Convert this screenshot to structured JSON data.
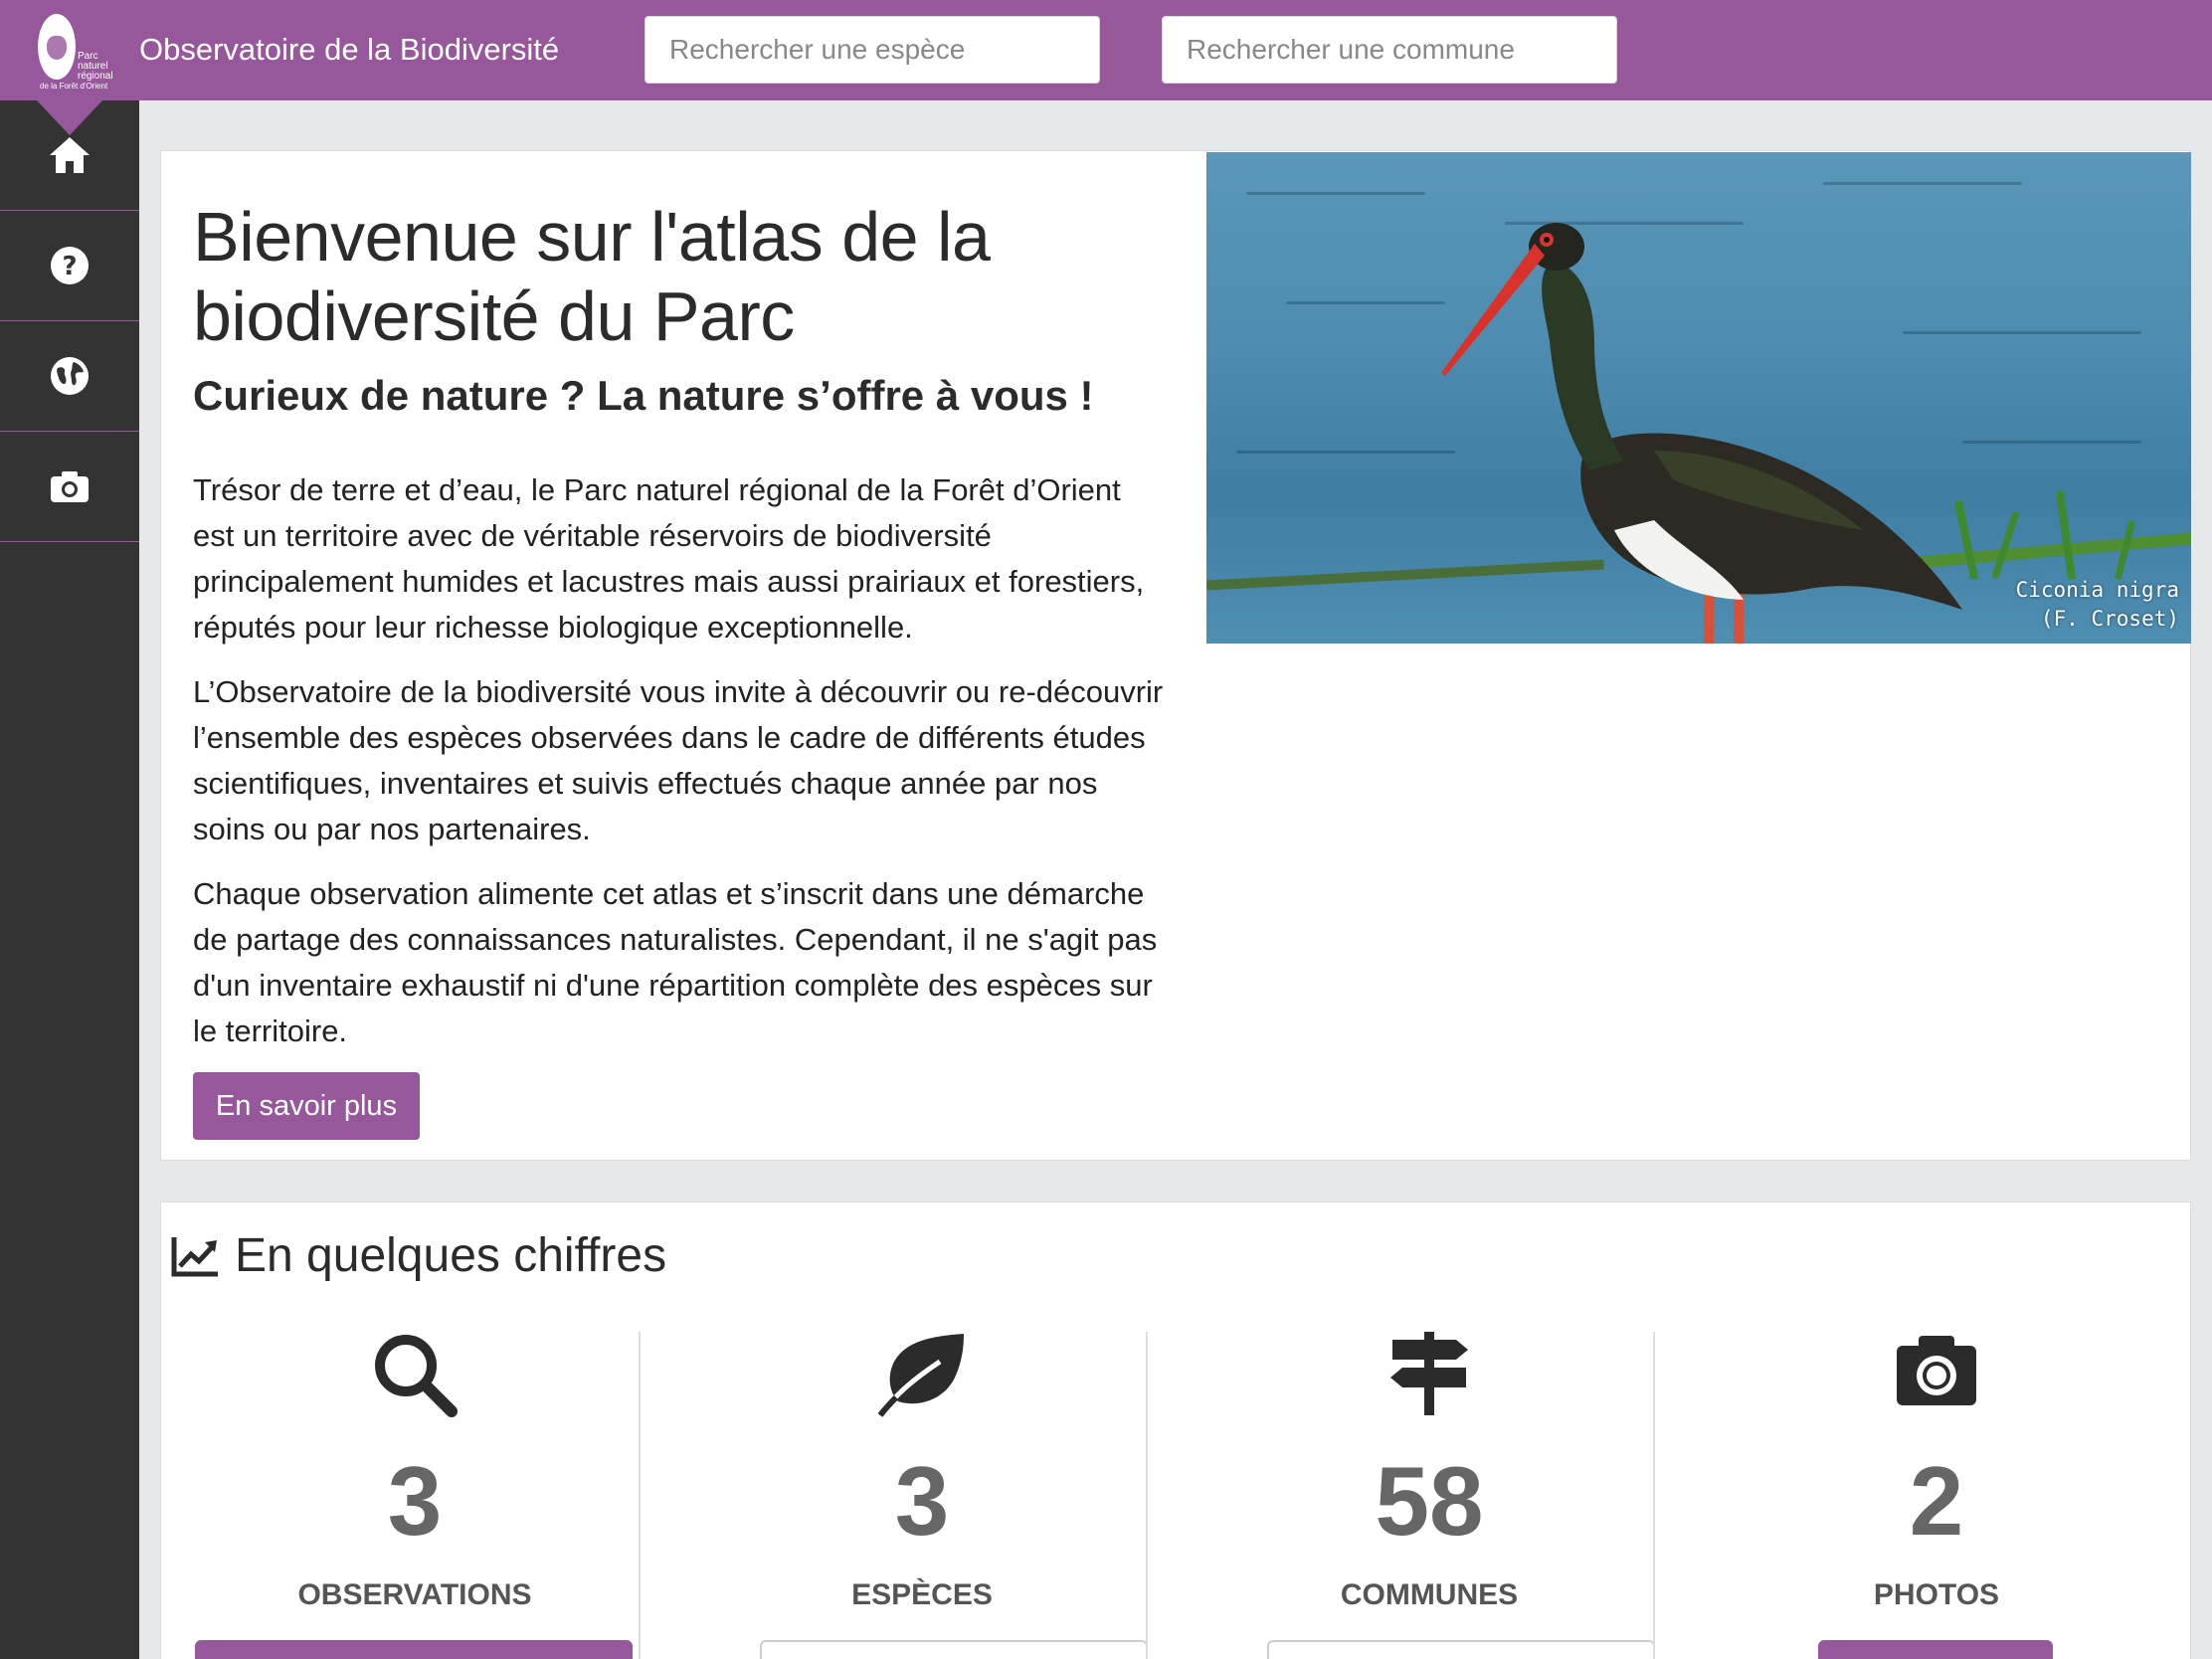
{
  "header": {
    "logo_text": "Parc naturel régional",
    "logo_subtext": "de la Forêt d'Orient",
    "title": "Observatoire de la Biodiversité",
    "search_species_placeholder": "Rechercher une espèce",
    "search_commune_placeholder": "Rechercher une commune"
  },
  "sidebar": {
    "items": [
      {
        "icon": "home-icon"
      },
      {
        "icon": "question-circle-icon"
      },
      {
        "icon": "globe-icon"
      },
      {
        "icon": "camera-icon"
      }
    ]
  },
  "intro": {
    "title": "Bienvenue sur l'atlas de la biodiversité du Parc",
    "subtitle": "Curieux de nature ? La nature s’offre à vous !",
    "paragraphs": [
      "Trésor de terre et d’eau, le Parc naturel régional de la Forêt d’Orient est un territoire avec de véritable réservoirs de biodiversité principalement humides et lacustres mais aussi prairiaux et forestiers, réputés pour leur richesse biologique exceptionnelle.",
      "L’Observatoire de la biodiversité vous invite à découvrir ou re-découvrir l’ensemble des espèces observées dans le cadre de différents études scientifiques, inventaires et suivis effectués chaque année par nos soins ou par nos partenaires.",
      "Chaque observation alimente cet atlas et s’inscrit dans une démarche de partage des connaissances naturalistes. Cependant, il ne s'agit pas d'un inventaire exhaustif ni d'une répartition complète des espèces sur le territoire."
    ],
    "more_button": "En savoir plus",
    "photo_caption_species": "Ciconia nigra",
    "photo_caption_author": "(F. Croset)"
  },
  "stats": {
    "title": "En quelques chiffres",
    "items": [
      {
        "icon": "search-icon",
        "value": "3",
        "label": "OBSERVATIONS"
      },
      {
        "icon": "leaf-icon",
        "value": "3",
        "label": "ESPÈCES"
      },
      {
        "icon": "signpost-icon",
        "value": "58",
        "label": "COMMUNES"
      },
      {
        "icon": "camera-icon",
        "value": "2",
        "label": "PHOTOS"
      }
    ]
  },
  "colors": {
    "accent": "#97579b",
    "sidebar": "#333333",
    "background": "#e6e8ea"
  }
}
